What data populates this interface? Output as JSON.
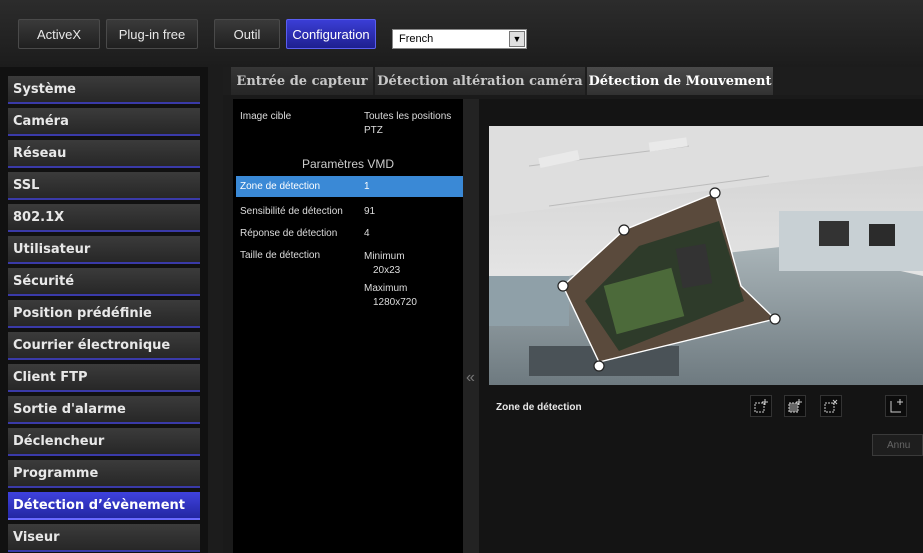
{
  "topbar": {
    "buttons": [
      {
        "label": "ActiveX"
      },
      {
        "label": "Plug-in free"
      },
      {
        "label": "Outil"
      },
      {
        "label": "Configuration"
      }
    ],
    "language_value": "French"
  },
  "sidebar": {
    "items": [
      {
        "label": "Système"
      },
      {
        "label": "Caméra"
      },
      {
        "label": "Réseau"
      },
      {
        "label": "SSL"
      },
      {
        "label": "802.1X"
      },
      {
        "label": "Utilisateur"
      },
      {
        "label": "Sécurité"
      },
      {
        "label": "Position prédéfinie"
      },
      {
        "label": "Courrier électronique"
      },
      {
        "label": "Client FTP"
      },
      {
        "label": "Sortie d'alarme"
      },
      {
        "label": "Déclencheur"
      },
      {
        "label": "Programme"
      },
      {
        "label": "Détection d’évènement"
      },
      {
        "label": "Viseur"
      }
    ],
    "active_item": "Détection d’évènement"
  },
  "tabs": [
    {
      "label": "Entrée de capteur"
    },
    {
      "label": "Détection altération caméra"
    },
    {
      "label": "Détection de Mouvement"
    }
  ],
  "params": {
    "target_label": "Image cible",
    "target_value_line1": "Toutes les positions",
    "target_value_line2": "PTZ",
    "vmd_title": "Paramètres VMD",
    "zone_label": "Zone de détection",
    "zone_value": "1",
    "sensitivity_label": "Sensibilité de détection",
    "sensitivity_value": "91",
    "response_label": "Réponse de détection",
    "response_value": "4",
    "size_label": "Taille de détection",
    "min_label": "Minimum",
    "min_value": "20x23",
    "max_label": "Maximum",
    "max_value": "1280x720"
  },
  "collapse_glyph": "«",
  "detection_area": {
    "label": "Zone de détection",
    "tools": [
      "add-rectangle-icon",
      "add-polygon-icon",
      "remove-rectangle-icon",
      "add-point-icon"
    ],
    "cancel_label": "Annu"
  }
}
